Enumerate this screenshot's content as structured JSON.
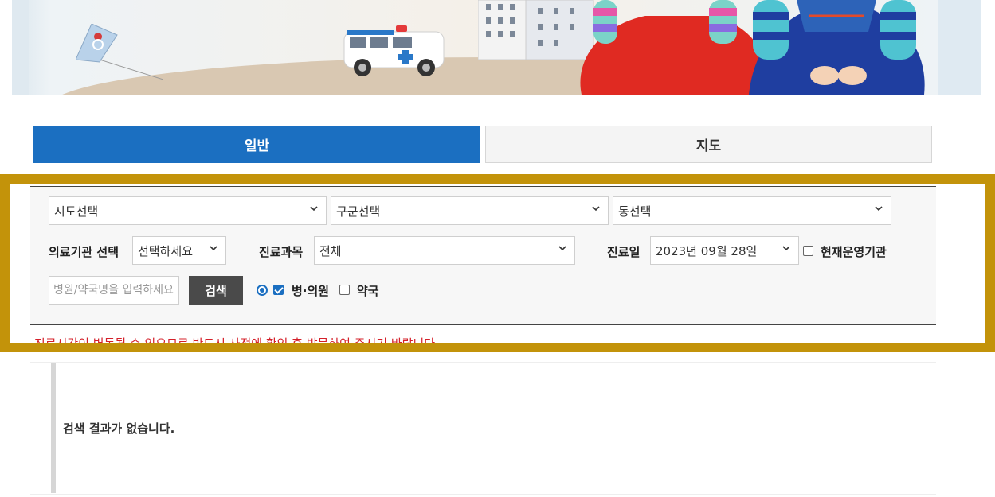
{
  "tabs": {
    "general": "일반",
    "map": "지도"
  },
  "filter": {
    "sido": "시도선택",
    "gugun": "구군선택",
    "dong": "동선택",
    "institution_label": "의료기관 선택",
    "institution_value": "선택하세요",
    "department_label": "진료과목",
    "department_value": "전체",
    "date_label": "진료일",
    "date_value": "2023년 09월 28일",
    "operating_label": "현재운영기관",
    "name_placeholder": "병원/약국명을 입력하세요",
    "search_label": "검색",
    "hospital_label": "병·의원",
    "pharmacy_label": "약국"
  },
  "notice": "진료시간이 변동될 수 있으므로 반드시 사전에 확인 후 방문하여 주시기 바랍니다.",
  "results": {
    "empty_message": "검색 결과가 없습니다."
  },
  "colors": {
    "accent": "#1b6fc1",
    "highlight": "#c3930a",
    "notice": "#d4202a"
  },
  "icons": [
    "chevron-down-icon",
    "checkbox-icon",
    "radio-icon"
  ]
}
